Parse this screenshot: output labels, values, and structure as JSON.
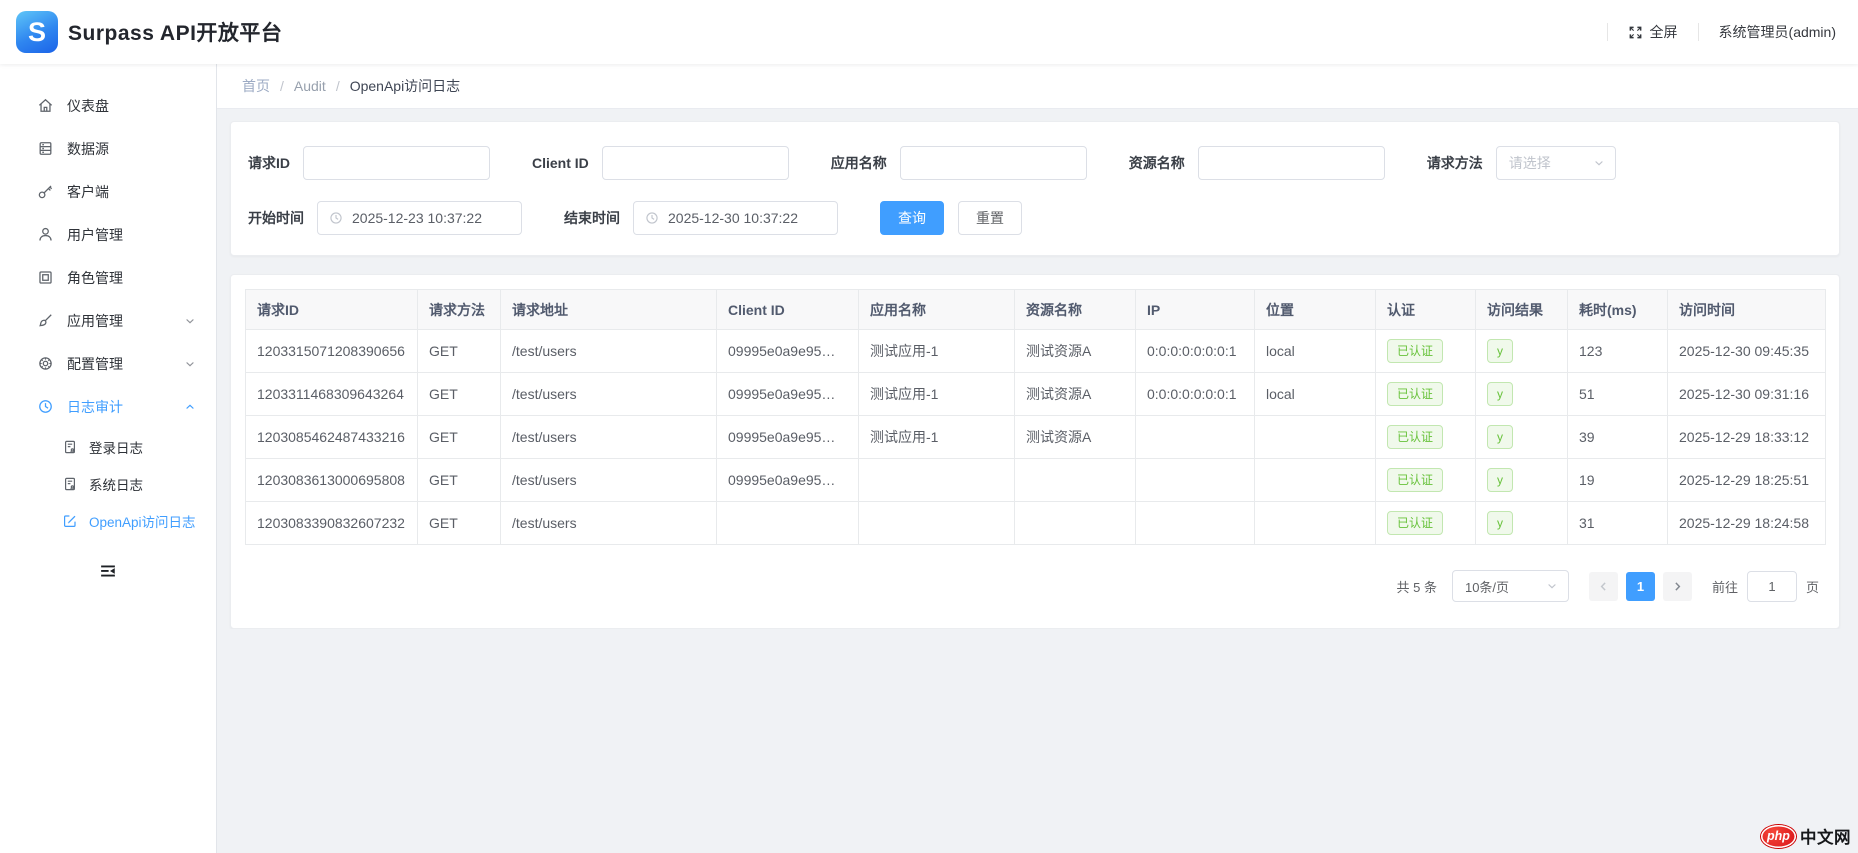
{
  "header": {
    "app_title": "Surpass API开放平台",
    "fullscreen_label": "全屏",
    "user_label": "系统管理员(admin)"
  },
  "breadcrumb": {
    "items": [
      "首页",
      "Audit",
      "OpenApi访问日志"
    ],
    "separator": "/"
  },
  "sidebar": {
    "items": [
      {
        "icon": "home-icon",
        "label": "仪表盘"
      },
      {
        "icon": "database-icon",
        "label": "数据源"
      },
      {
        "icon": "key-icon",
        "label": "客户端"
      },
      {
        "icon": "user-icon",
        "label": "用户管理"
      },
      {
        "icon": "role-icon",
        "label": "角色管理"
      },
      {
        "icon": "brush-icon",
        "label": "应用管理",
        "chevron": "down"
      },
      {
        "icon": "badge-icon",
        "label": "配置管理",
        "chevron": "down"
      },
      {
        "icon": "clock-icon",
        "label": "日志审计",
        "chevron": "up",
        "active": true
      }
    ],
    "subitems": [
      {
        "icon": "login-log-icon",
        "label": "登录日志"
      },
      {
        "icon": "system-log-icon",
        "label": "系统日志"
      },
      {
        "icon": "edit-icon",
        "label": "OpenApi访问日志",
        "active": true
      }
    ]
  },
  "filters": {
    "request_id_label": "请求ID",
    "client_id_label": "Client ID",
    "app_name_label": "应用名称",
    "resource_name_label": "资源名称",
    "method_label": "请求方法",
    "method_placeholder": "请选择",
    "start_time_label": "开始时间",
    "start_time_value": "2025-12-23 10:37:22",
    "end_time_label": "结束时间",
    "end_time_value": "2025-12-30 10:37:22",
    "search_button": "查询",
    "reset_button": "重置"
  },
  "table": {
    "columns": [
      "请求ID",
      "请求方法",
      "请求地址",
      "Client ID",
      "应用名称",
      "资源名称",
      "IP",
      "位置",
      "认证",
      "访问结果",
      "耗时(ms)",
      "访问时间"
    ],
    "rows": [
      {
        "request_id": "1203315071208390656",
        "method": "GET",
        "url": "/test/users",
        "client_id": "09995e0a9e95…",
        "app_name": "测试应用-1",
        "resource": "测试资源A",
        "ip": "0:0:0:0:0:0:0:1",
        "location": "local",
        "auth": "已认证",
        "result": "y",
        "cost_ms": "123",
        "time": "2025-12-30 09:45:35"
      },
      {
        "request_id": "1203311468309643264",
        "method": "GET",
        "url": "/test/users",
        "client_id": "09995e0a9e95…",
        "app_name": "测试应用-1",
        "resource": "测试资源A",
        "ip": "0:0:0:0:0:0:0:1",
        "location": "local",
        "auth": "已认证",
        "result": "y",
        "cost_ms": "51",
        "time": "2025-12-30 09:31:16"
      },
      {
        "request_id": "1203085462487433216",
        "method": "GET",
        "url": "/test/users",
        "client_id": "09995e0a9e95…",
        "app_name": "测试应用-1",
        "resource": "测试资源A",
        "ip": "",
        "location": "",
        "auth": "已认证",
        "result": "y",
        "cost_ms": "39",
        "time": "2025-12-29 18:33:12"
      },
      {
        "request_id": "1203083613000695808",
        "method": "GET",
        "url": "/test/users",
        "client_id": "09995e0a9e95…",
        "app_name": "",
        "resource": "",
        "ip": "",
        "location": "",
        "auth": "已认证",
        "result": "y",
        "cost_ms": "19",
        "time": "2025-12-29 18:25:51"
      },
      {
        "request_id": "1203083390832607232",
        "method": "GET",
        "url": "/test/users",
        "client_id": "",
        "app_name": "",
        "resource": "",
        "ip": "",
        "location": "",
        "auth": "已认证",
        "result": "y",
        "cost_ms": "31",
        "time": "2025-12-29 18:24:58"
      }
    ]
  },
  "pagination": {
    "total_label": "共 5 条",
    "page_size": "10条/页",
    "current_page": "1",
    "goto_label": "前往",
    "goto_value": "1",
    "page_unit": "页"
  },
  "watermark": {
    "badge": "php",
    "text": "中文网"
  },
  "colors": {
    "primary": "#409eff",
    "success_text": "#67c23a",
    "success_bg": "#f0f9eb",
    "success_border": "#c2e7b0",
    "page_bg": "#f0f2f5",
    "header_bg": "#ffffff"
  }
}
